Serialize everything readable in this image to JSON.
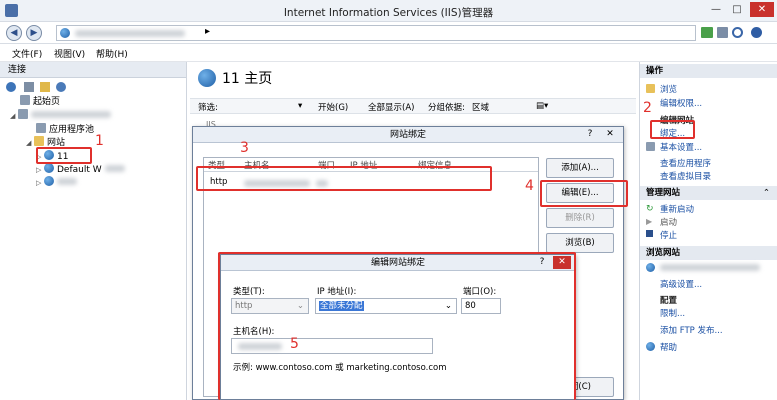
{
  "window": {
    "title": "Internet Information Services (IIS)管理器",
    "minimize": "—",
    "maximize": "□",
    "close": "✕"
  },
  "address": {
    "back": "◀",
    "forward": "▶",
    "arrow": "▸"
  },
  "menu": {
    "file": "文件(F)",
    "view": "视图(V)",
    "help": "帮助(H)"
  },
  "left": {
    "header": "连接",
    "tree": {
      "start": "起始页",
      "app_pools": "应用程序池",
      "sites": "网站",
      "site11": "11",
      "default": "Default W"
    }
  },
  "center": {
    "title": "11 主页",
    "filter_label": "筛选:",
    "start": "开始(G)",
    "show_all": "全部显示(A)",
    "group_by": "分组依据:",
    "group_value": "区域",
    "iis": "IIS"
  },
  "site_bindings": {
    "title": "网站绑定",
    "help": "?",
    "close": "✕",
    "columns": [
      "类型",
      "主机名",
      "端口",
      "IP 地址",
      "绑定信息"
    ],
    "row_type": "http",
    "add": "添加(A)...",
    "edit": "编辑(E)...",
    "remove": "删除(R)",
    "browse": "浏览(B)",
    "close_btn": "关闭(C)"
  },
  "edit_binding": {
    "title": "编辑网站绑定",
    "help": "?",
    "close": "✕",
    "type_label": "类型(T):",
    "type_value": "http",
    "ip_label": "IP 地址(I):",
    "ip_value": "全部未分配",
    "port_label": "端口(O):",
    "port_value": "80",
    "host_label": "主机名(H):",
    "example": "示例: www.contoso.com 或 marketing.contoso.com"
  },
  "right": {
    "header": "操作",
    "browse": "浏览",
    "edit_perms": "编辑权限...",
    "edit_site_head": "编辑网站",
    "bindings": "绑定...",
    "basic_settings": "基本设置...",
    "view_apps": "查看应用程序",
    "view_vdirs": "查看虚拟目录",
    "manage_site_head": "管理网站",
    "restart": "重新启动",
    "start": "启动",
    "stop": "停止",
    "browse_site_head": "浏览网站",
    "advanced": "高级设置...",
    "config_head": "配置",
    "limits": "限制...",
    "add_ftp": "添加 FTP 发布...",
    "help": "帮助"
  },
  "annotations": {
    "n1": "1",
    "n2": "2",
    "n3": "3",
    "n4": "4",
    "n5": "5",
    "color": "#e0302c"
  }
}
